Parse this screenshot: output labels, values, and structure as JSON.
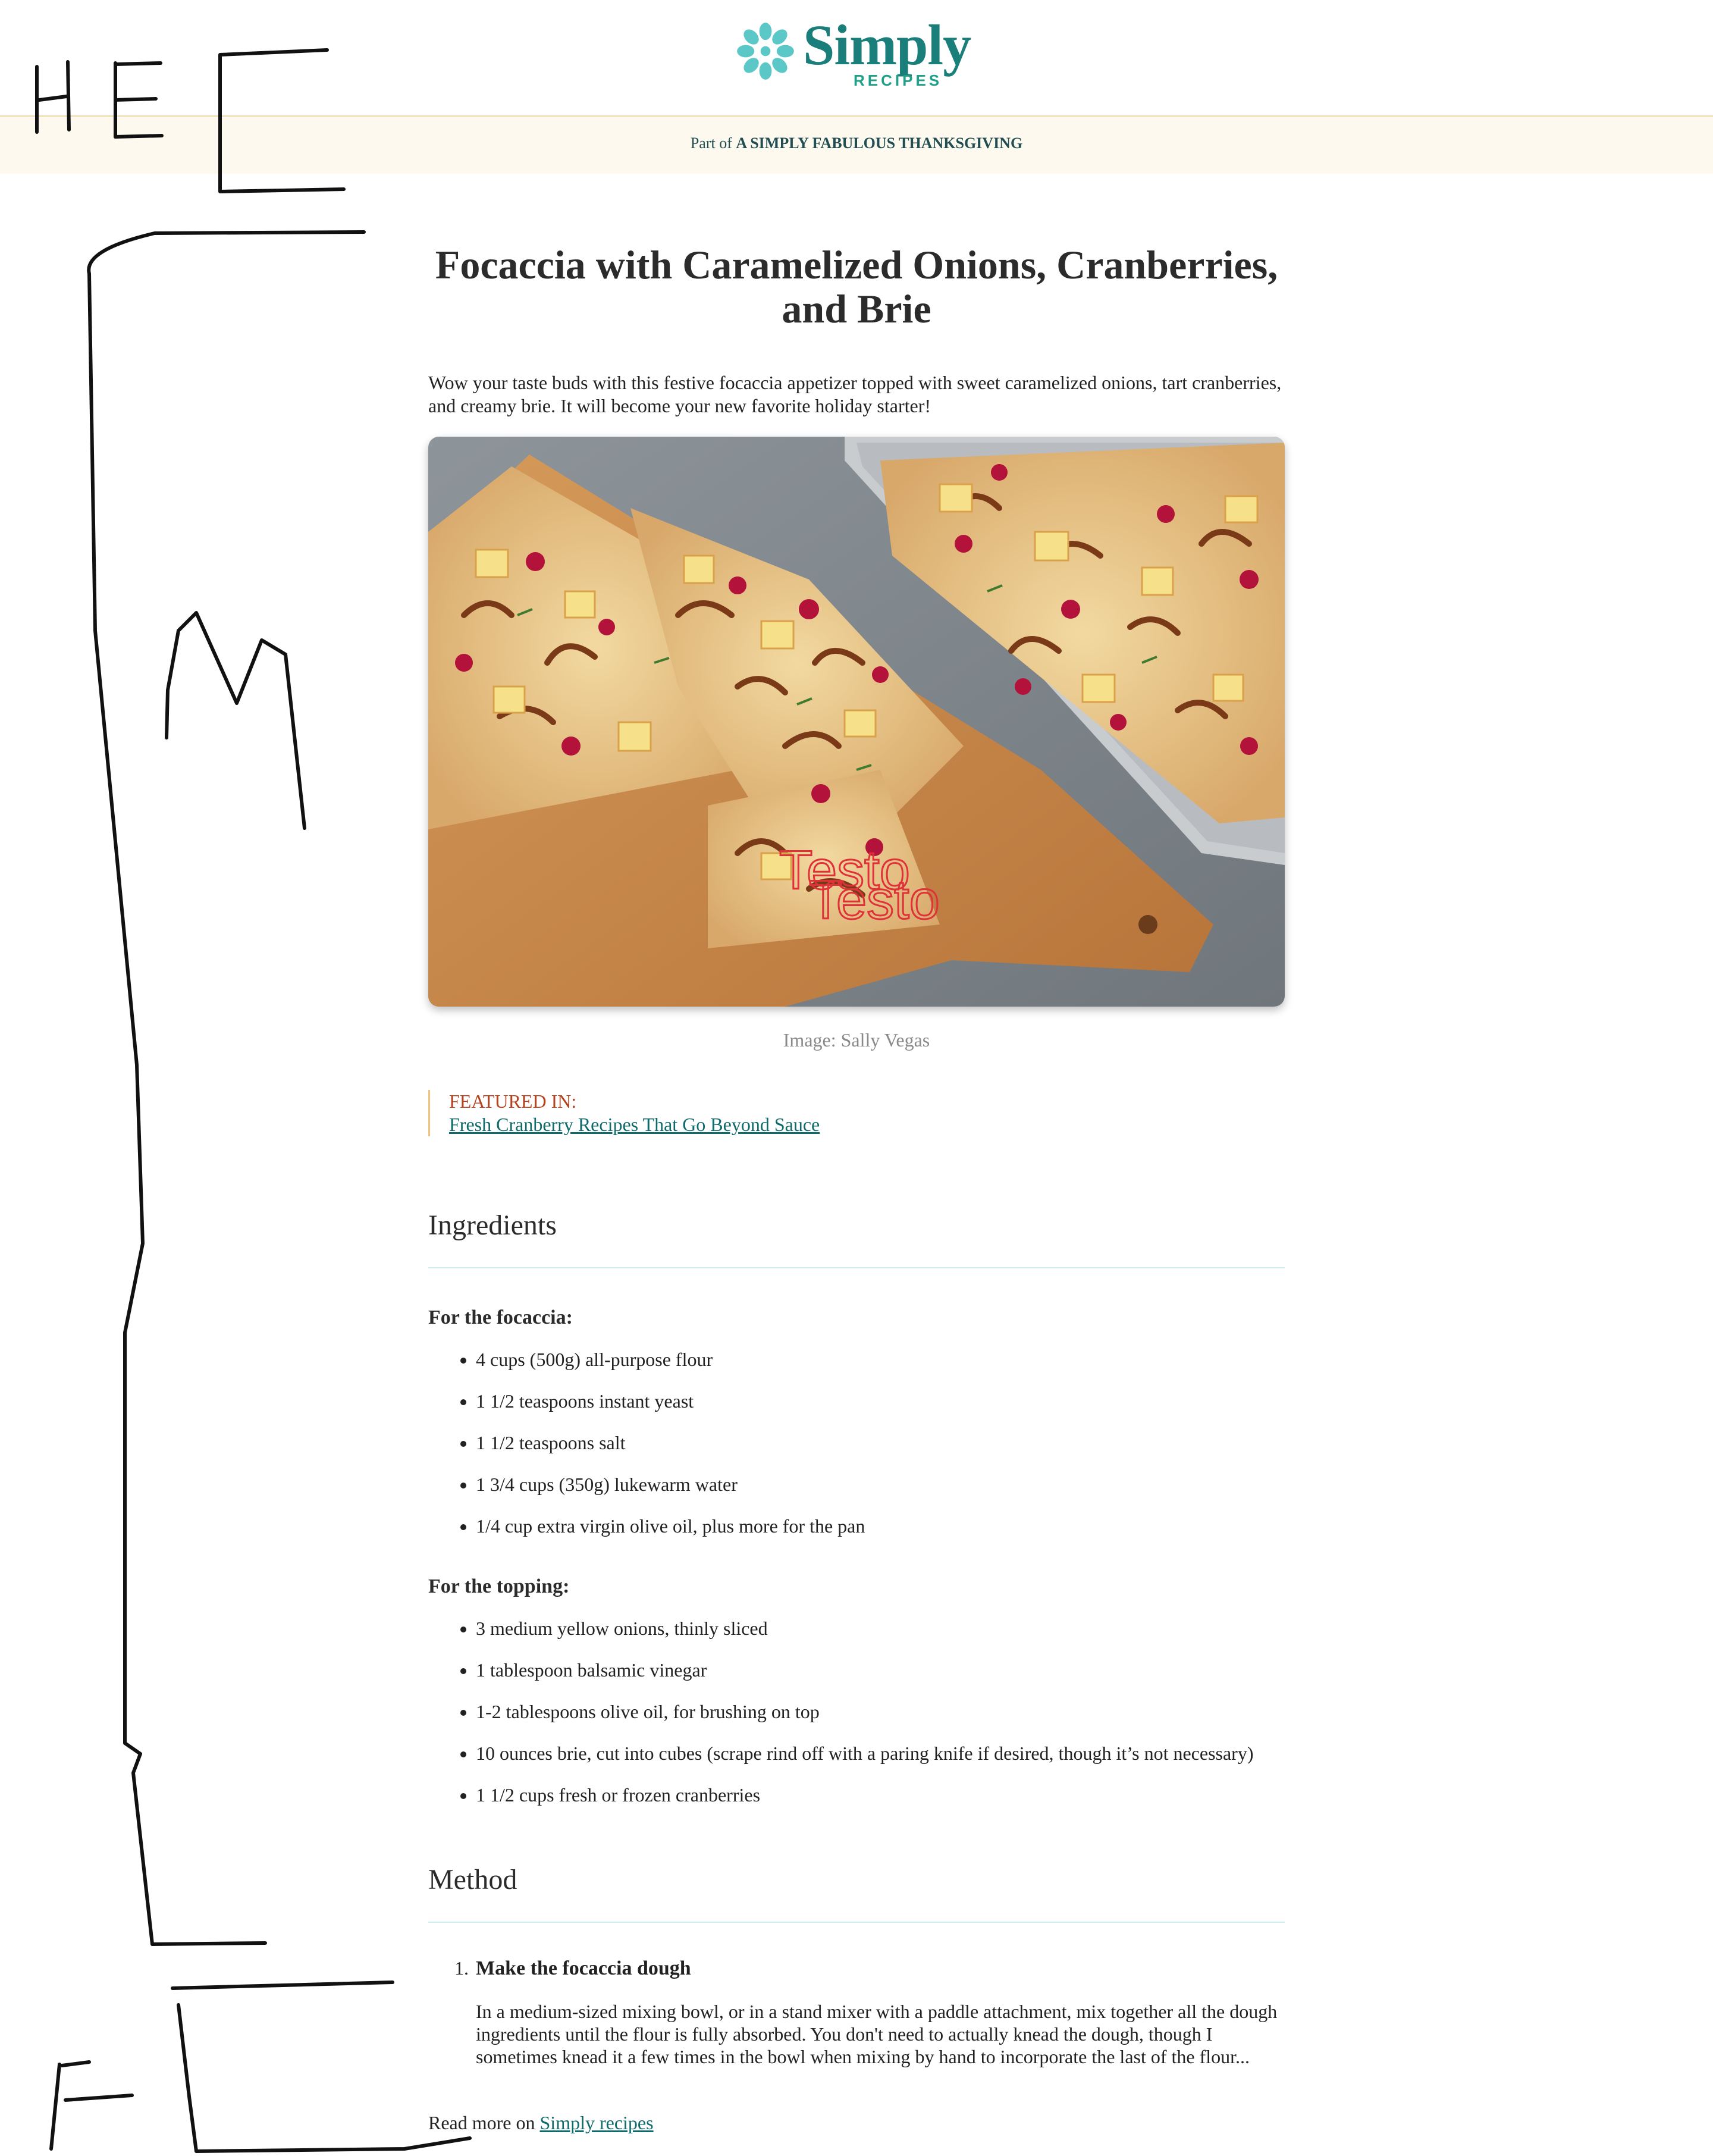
{
  "header": {
    "logo_word": "Simply",
    "logo_sub": "RECIPES",
    "part_of_prefix": "Part of",
    "part_of_collection": "A SIMPLY FABULOUS THANKSGIVING"
  },
  "annotations": {
    "header_label": "HE",
    "main_label": "M",
    "footer_label": "F"
  },
  "article": {
    "title": "Focaccia with Caramelized Onions, Cranberries, and Brie",
    "intro": "Wow your taste buds with this festive focaccia appetizer topped with sweet caramelized onions, tart cranberries, and creamy brie. It will become your new favorite holiday starter!",
    "image_alt": "Focaccia with caramelized onions, cranberries and brie on a wooden cutting board",
    "image_overlay_text": "Testo",
    "caption": "Image: Sally Vegas",
    "featured_label": "FEATURED IN:",
    "featured_link": "Fresh Cranberry Recipes That Go Beyond Sauce"
  },
  "ingredients": {
    "heading": "Ingredients",
    "groups": [
      {
        "title": "For the focaccia:",
        "items": [
          "4 cups (500g) all-purpose flour",
          "1 1/2 teaspoons instant yeast",
          "1 1/2 teaspoons salt",
          "1 3/4 cups (350g) lukewarm water",
          "1/4 cup extra virgin olive oil, plus more for the pan"
        ]
      },
      {
        "title": "For the topping:",
        "items": [
          "3 medium yellow onions, thinly sliced",
          "1 tablespoon balsamic vinegar",
          "1-2 tablespoons olive oil, for brushing on top",
          "10 ounces brie, cut into cubes (scrape rind off with a paring knife if desired, though it’s not necessary)",
          "1 1/2 cups fresh or frozen cranberries"
        ]
      }
    ]
  },
  "method": {
    "heading": "Method",
    "steps": [
      {
        "number": "1.",
        "title": "Make the focaccia dough",
        "body": "In a medium-sized mixing bowl, or in a stand mixer with a paddle attachment, mix together all the dough ingredients until the flour is fully absorbed. You don't need to actually knead the dough, though I sometimes knead it a few times in the bowl when mixing by hand to incorporate the last of the flour..."
      }
    ]
  },
  "read_more": {
    "prefix": "Read more on",
    "link": "Simply recipes"
  },
  "colors": {
    "brand_teal": "#1a7f7a",
    "logo_flower": "#5cc7c7",
    "featured_label": "#b5421d",
    "link": "#0f6b6b",
    "subbar_bg": "#fdf9ee"
  }
}
